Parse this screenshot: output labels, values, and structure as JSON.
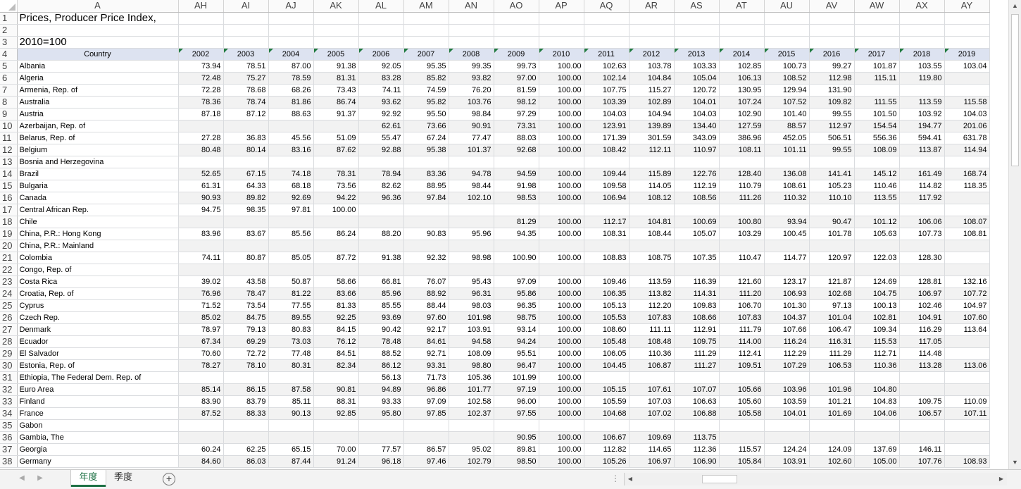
{
  "columns": [
    "A",
    "AH",
    "AI",
    "AJ",
    "AK",
    "AL",
    "AM",
    "AN",
    "AO",
    "AP",
    "AQ",
    "AR",
    "AS",
    "AT",
    "AU",
    "AV",
    "AW",
    "AX",
    "AY"
  ],
  "banner": {
    "title": "Prices, Producer Price Index,",
    "base": "2010=100"
  },
  "header": {
    "country_label": "Country",
    "years": [
      "2002",
      "2003",
      "2004",
      "2005",
      "2006",
      "2007",
      "2008",
      "2009",
      "2010",
      "2011",
      "2012",
      "2013",
      "2014",
      "2015",
      "2016",
      "2017",
      "2018",
      "2019"
    ]
  },
  "data_rows": [
    {
      "row": "5",
      "country": "Albania",
      "values": [
        "73.94",
        "78.51",
        "87.00",
        "91.38",
        "92.05",
        "95.35",
        "99.35",
        "99.73",
        "100.00",
        "102.63",
        "103.78",
        "103.33",
        "102.85",
        "100.73",
        "99.27",
        "101.87",
        "103.55",
        "103.04"
      ]
    },
    {
      "row": "6",
      "country": "Algeria",
      "values": [
        "72.48",
        "75.27",
        "78.59",
        "81.31",
        "83.28",
        "85.82",
        "93.82",
        "97.00",
        "100.00",
        "102.14",
        "104.84",
        "105.04",
        "106.13",
        "108.52",
        "112.98",
        "115.11",
        "119.80",
        ""
      ]
    },
    {
      "row": "7",
      "country": "Armenia, Rep. of",
      "values": [
        "72.28",
        "78.68",
        "68.26",
        "73.43",
        "74.11",
        "74.59",
        "76.20",
        "81.59",
        "100.00",
        "107.75",
        "115.27",
        "120.72",
        "130.95",
        "129.94",
        "131.90",
        "",
        "",
        ""
      ]
    },
    {
      "row": "8",
      "country": "Australia",
      "values": [
        "78.36",
        "78.74",
        "81.86",
        "86.74",
        "93.62",
        "95.82",
        "103.76",
        "98.12",
        "100.00",
        "103.39",
        "102.89",
        "104.01",
        "107.24",
        "107.52",
        "109.82",
        "111.55",
        "113.59",
        "115.58"
      ]
    },
    {
      "row": "9",
      "country": "Austria",
      "values": [
        "87.18",
        "87.12",
        "88.63",
        "91.37",
        "92.92",
        "95.50",
        "98.84",
        "97.29",
        "100.00",
        "104.03",
        "104.94",
        "104.03",
        "102.90",
        "101.40",
        "99.55",
        "101.50",
        "103.92",
        "104.03"
      ]
    },
    {
      "row": "10",
      "country": "Azerbaijan, Rep. of",
      "values": [
        "",
        "",
        "",
        "",
        "62.61",
        "73.66",
        "90.91",
        "73.31",
        "100.00",
        "123.91",
        "139.89",
        "134.40",
        "127.59",
        "88.57",
        "112.97",
        "154.54",
        "194.77",
        "201.06"
      ]
    },
    {
      "row": "11",
      "country": "Belarus, Rep. of",
      "values": [
        "27.28",
        "36.83",
        "45.56",
        "51.09",
        "55.47",
        "67.24",
        "77.47",
        "88.03",
        "100.00",
        "171.39",
        "301.59",
        "343.09",
        "386.96",
        "452.05",
        "506.51",
        "556.36",
        "594.41",
        "631.78"
      ]
    },
    {
      "row": "12",
      "country": "Belgium",
      "values": [
        "80.48",
        "80.14",
        "83.16",
        "87.62",
        "92.88",
        "95.38",
        "101.37",
        "92.68",
        "100.00",
        "108.42",
        "112.11",
        "110.97",
        "108.11",
        "101.11",
        "99.55",
        "108.09",
        "113.87",
        "114.94"
      ]
    },
    {
      "row": "13",
      "country": "Bosnia and Herzegovina",
      "values": [
        "",
        "",
        "",
        "",
        "",
        "",
        "",
        "",
        "",
        "",
        "",
        "",
        "",
        "",
        "",
        "",
        "",
        ""
      ]
    },
    {
      "row": "14",
      "country": "Brazil",
      "values": [
        "52.65",
        "67.15",
        "74.18",
        "78.31",
        "78.94",
        "83.36",
        "94.78",
        "94.59",
        "100.00",
        "109.44",
        "115.89",
        "122.76",
        "128.40",
        "136.08",
        "141.41",
        "145.12",
        "161.49",
        "168.74"
      ]
    },
    {
      "row": "15",
      "country": "Bulgaria",
      "values": [
        "61.31",
        "64.33",
        "68.18",
        "73.56",
        "82.62",
        "88.95",
        "98.44",
        "91.98",
        "100.00",
        "109.58",
        "114.05",
        "112.19",
        "110.79",
        "108.61",
        "105.23",
        "110.46",
        "114.82",
        "118.35"
      ]
    },
    {
      "row": "16",
      "country": "Canada",
      "values": [
        "90.93",
        "89.82",
        "92.69",
        "94.22",
        "96.36",
        "97.84",
        "102.10",
        "98.53",
        "100.00",
        "106.94",
        "108.12",
        "108.56",
        "111.26",
        "110.32",
        "110.10",
        "113.55",
        "117.92",
        ""
      ]
    },
    {
      "row": "17",
      "country": "Central African Rep.",
      "values": [
        "94.75",
        "98.35",
        "97.81",
        "100.00",
        "",
        "",
        "",
        "",
        "",
        "",
        "",
        "",
        "",
        "",
        "",
        "",
        "",
        ""
      ]
    },
    {
      "row": "18",
      "country": "Chile",
      "values": [
        "",
        "",
        "",
        "",
        "",
        "",
        "",
        "81.29",
        "100.00",
        "112.17",
        "104.81",
        "100.69",
        "100.80",
        "93.94",
        "90.47",
        "101.12",
        "106.06",
        "108.07"
      ]
    },
    {
      "row": "19",
      "country": "China, P.R.: Hong Kong",
      "values": [
        "83.96",
        "83.67",
        "85.56",
        "86.24",
        "88.20",
        "90.83",
        "95.96",
        "94.35",
        "100.00",
        "108.31",
        "108.44",
        "105.07",
        "103.29",
        "100.45",
        "101.78",
        "105.63",
        "107.73",
        "108.81"
      ]
    },
    {
      "row": "20",
      "country": "China, P.R.: Mainland",
      "values": [
        "",
        "",
        "",
        "",
        "",
        "",
        "",
        "",
        "",
        "",
        "",
        "",
        "",
        "",
        "",
        "",
        "",
        ""
      ]
    },
    {
      "row": "21",
      "country": "Colombia",
      "values": [
        "74.11",
        "80.87",
        "85.05",
        "87.72",
        "91.38",
        "92.32",
        "98.98",
        "100.90",
        "100.00",
        "108.83",
        "108.75",
        "107.35",
        "110.47",
        "114.77",
        "120.97",
        "122.03",
        "128.30",
        ""
      ]
    },
    {
      "row": "22",
      "country": "Congo, Rep. of",
      "values": [
        "",
        "",
        "",
        "",
        "",
        "",
        "",
        "",
        "",
        "",
        "",
        "",
        "",
        "",
        "",
        "",
        "",
        ""
      ]
    },
    {
      "row": "23",
      "country": "Costa Rica",
      "values": [
        "39.02",
        "43.58",
        "50.87",
        "58.66",
        "66.81",
        "76.07",
        "95.43",
        "97.09",
        "100.00",
        "109.46",
        "113.59",
        "116.39",
        "121.60",
        "123.17",
        "121.87",
        "124.69",
        "128.81",
        "132.16"
      ]
    },
    {
      "row": "24",
      "country": "Croatia, Rep. of",
      "values": [
        "76.96",
        "78.47",
        "81.22",
        "83.66",
        "85.96",
        "88.92",
        "96.31",
        "95.86",
        "100.00",
        "106.35",
        "113.82",
        "114.31",
        "111.20",
        "106.93",
        "102.68",
        "104.75",
        "106.97",
        "107.72"
      ]
    },
    {
      "row": "25",
      "country": "Cyprus",
      "values": [
        "71.52",
        "73.54",
        "77.55",
        "81.33",
        "85.55",
        "88.44",
        "98.03",
        "96.35",
        "100.00",
        "105.13",
        "112.20",
        "109.83",
        "106.70",
        "101.30",
        "97.13",
        "100.13",
        "102.46",
        "104.97"
      ]
    },
    {
      "row": "26",
      "country": "Czech Rep.",
      "values": [
        "85.02",
        "84.75",
        "89.55",
        "92.25",
        "93.69",
        "97.60",
        "101.98",
        "98.75",
        "100.00",
        "105.53",
        "107.83",
        "108.66",
        "107.83",
        "104.37",
        "101.04",
        "102.81",
        "104.91",
        "107.60"
      ]
    },
    {
      "row": "27",
      "country": "Denmark",
      "values": [
        "78.97",
        "79.13",
        "80.83",
        "84.15",
        "90.42",
        "92.17",
        "103.91",
        "93.14",
        "100.00",
        "108.60",
        "111.11",
        "112.91",
        "111.79",
        "107.66",
        "106.47",
        "109.34",
        "116.29",
        "113.64"
      ]
    },
    {
      "row": "28",
      "country": "Ecuador",
      "values": [
        "67.34",
        "69.29",
        "73.03",
        "76.12",
        "78.48",
        "84.61",
        "94.58",
        "94.24",
        "100.00",
        "105.48",
        "108.48",
        "109.75",
        "114.00",
        "116.24",
        "116.31",
        "115.53",
        "117.05",
        ""
      ]
    },
    {
      "row": "29",
      "country": "El Salvador",
      "values": [
        "70.60",
        "72.72",
        "77.48",
        "84.51",
        "88.52",
        "92.71",
        "108.09",
        "95.51",
        "100.00",
        "106.05",
        "110.36",
        "111.29",
        "112.41",
        "112.29",
        "111.29",
        "112.71",
        "114.48",
        ""
      ]
    },
    {
      "row": "30",
      "country": "Estonia, Rep. of",
      "values": [
        "78.27",
        "78.10",
        "80.31",
        "82.34",
        "86.12",
        "93.31",
        "98.80",
        "96.47",
        "100.00",
        "104.45",
        "106.87",
        "111.27",
        "109.51",
        "107.29",
        "106.53",
        "110.36",
        "113.28",
        "113.06"
      ]
    },
    {
      "row": "31",
      "country": "Ethiopia, The Federal Dem. Rep. of",
      "values": [
        "",
        "",
        "",
        "",
        "56.13",
        "71.73",
        "105.36",
        "101.99",
        "100.00",
        "",
        "",
        "",
        "",
        "",
        "",
        "",
        "",
        ""
      ]
    },
    {
      "row": "32",
      "country": "Euro Area",
      "values": [
        "85.14",
        "86.15",
        "87.58",
        "90.81",
        "94.89",
        "96.86",
        "101.77",
        "97.19",
        "100.00",
        "105.15",
        "107.61",
        "107.07",
        "105.66",
        "103.96",
        "101.96",
        "104.80",
        "",
        ""
      ]
    },
    {
      "row": "33",
      "country": "Finland",
      "values": [
        "83.90",
        "83.79",
        "85.11",
        "88.31",
        "93.33",
        "97.09",
        "102.58",
        "96.00",
        "100.00",
        "105.59",
        "107.03",
        "106.63",
        "105.60",
        "103.59",
        "101.21",
        "104.83",
        "109.75",
        "110.09"
      ]
    },
    {
      "row": "34",
      "country": "France",
      "values": [
        "87.52",
        "88.33",
        "90.13",
        "92.85",
        "95.80",
        "97.85",
        "102.37",
        "97.55",
        "100.00",
        "104.68",
        "107.02",
        "106.88",
        "105.58",
        "104.01",
        "101.69",
        "104.06",
        "106.57",
        "107.11"
      ]
    },
    {
      "row": "35",
      "country": "Gabon",
      "values": [
        "",
        "",
        "",
        "",
        "",
        "",
        "",
        "",
        "",
        "",
        "",
        "",
        "",
        "",
        "",
        "",
        "",
        ""
      ]
    },
    {
      "row": "36",
      "country": "Gambia, The",
      "values": [
        "",
        "",
        "",
        "",
        "",
        "",
        "",
        "90.95",
        "100.00",
        "106.67",
        "109.69",
        "113.75",
        "",
        "",
        "",
        "",
        "",
        ""
      ]
    },
    {
      "row": "37",
      "country": "Georgia",
      "values": [
        "60.24",
        "62.25",
        "65.15",
        "70.00",
        "77.57",
        "86.57",
        "95.02",
        "89.81",
        "100.00",
        "112.82",
        "114.65",
        "112.36",
        "115.57",
        "124.24",
        "124.09",
        "137.69",
        "146.11",
        ""
      ]
    },
    {
      "row": "38",
      "country": "Germany",
      "values": [
        "84.60",
        "86.03",
        "87.44",
        "91.24",
        "96.18",
        "97.46",
        "102.79",
        "98.50",
        "100.00",
        "105.26",
        "106.97",
        "106.90",
        "105.84",
        "103.91",
        "102.60",
        "105.00",
        "107.76",
        "108.93"
      ]
    }
  ],
  "sheets": {
    "active": "年度",
    "other": "季度"
  },
  "icons": {
    "add_sheet": "plus-circle-icon",
    "scroll_left": "triangle-left-icon",
    "scroll_right": "triangle-right-icon",
    "scroll_up": "triangle-up-icon",
    "scroll_down": "triangle-down-icon",
    "options": "ellipsis-icon"
  },
  "colors": {
    "header_fill": "#dde3f1",
    "stripe_fill": "#f2f2f2",
    "accent": "#1e7145",
    "indicator": "#1f7a3f"
  }
}
